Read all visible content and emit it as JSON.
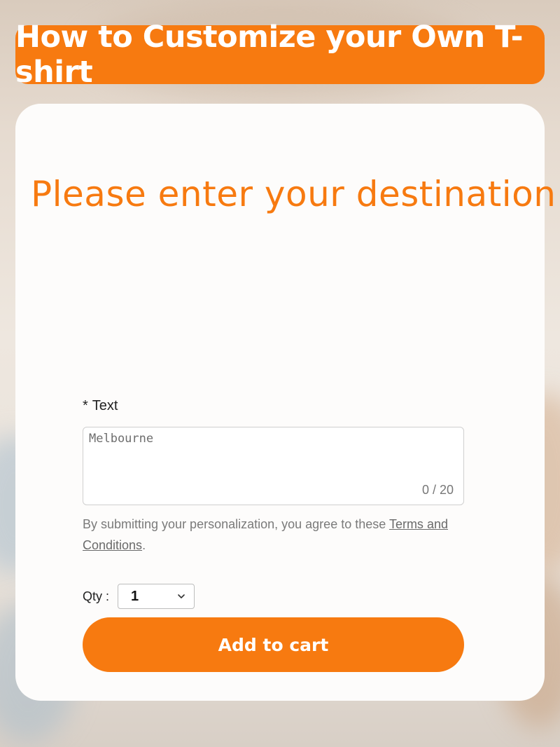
{
  "banner": {
    "title": "How to Customize your Own T-shirt"
  },
  "instruction": {
    "headline": "Please enter your destination !"
  },
  "form": {
    "required_mark": "*",
    "field_label": "Text",
    "text_value": "Melbourne",
    "char_counter": "0 / 20",
    "terms_prefix": "By submitting your personalization, you agree to these ",
    "terms_link": "Terms and Conditions",
    "terms_suffix": ".",
    "qty_label": "Qty :",
    "qty_value": "1",
    "add_to_cart_label": "Add to cart"
  },
  "colors": {
    "accent": "#f77a10",
    "card": "#fdfcfb"
  },
  "icons": {
    "qty_dropdown": "chevron-down-icon"
  }
}
